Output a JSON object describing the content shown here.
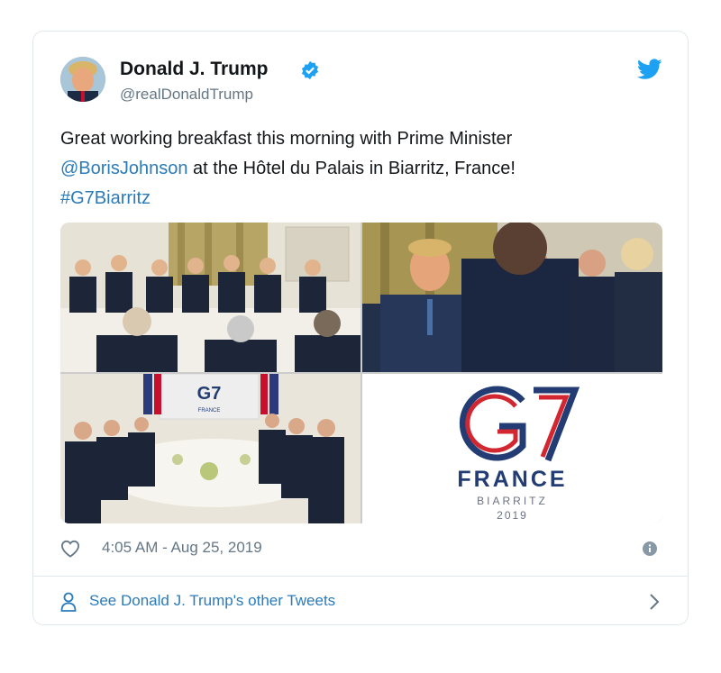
{
  "tweet": {
    "author_name": "Donald J. Trump",
    "handle": "@realDonaldTrump",
    "text_part1": "Great working breakfast this morning with Prime Minister",
    "mention": "@BorisJohnson",
    "text_part2": " at the Hôtel du Palais in Biarritz, France!",
    "hashtag": "#G7Biarritz",
    "timestamp": "4:05 AM - Aug 25, 2019"
  },
  "media": {
    "logo_letters": "G7",
    "logo_country": "FRANCE",
    "logo_city": "BIARRITZ",
    "logo_year": "2019",
    "backdrop_logo": "G7",
    "backdrop_sub": "FRANCE"
  },
  "footer": {
    "see_more": "See Donald J. Trump's other Tweets"
  },
  "colors": {
    "link": "#2b7bb9",
    "twitter_blue": "#1da1f2",
    "g7_navy": "#233c74",
    "g7_red": "#d22630"
  },
  "icons": [
    "verified-badge-icon",
    "twitter-bird-icon",
    "heart-icon",
    "info-icon",
    "person-icon",
    "chevron-right-icon"
  ]
}
